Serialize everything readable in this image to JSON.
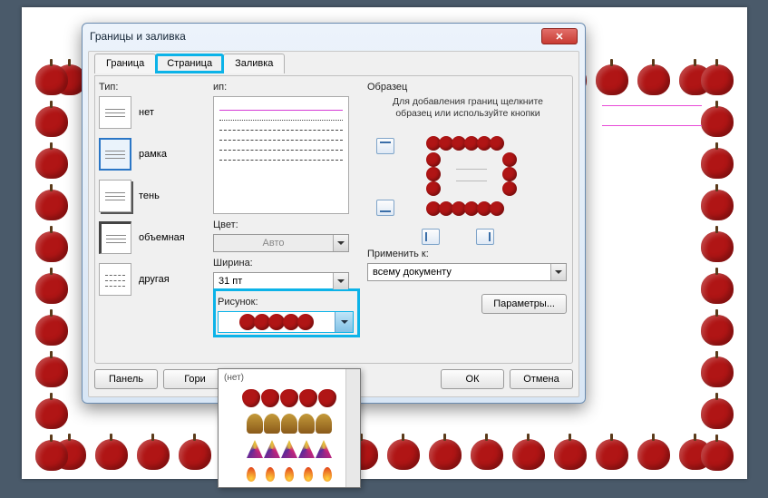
{
  "dialog": {
    "title": "Границы и заливка",
    "tabs": {
      "border": "Граница",
      "page": "Страница",
      "fill": "Заливка"
    },
    "type_label": "Тип:",
    "settings": {
      "none": "нет",
      "box": "рамка",
      "shadow": "тень",
      "threed": "объемная",
      "custom": "другая"
    },
    "style_label": "ип:",
    "color_label": "Цвет:",
    "color_value": "Авто",
    "width_label": "Ширина:",
    "width_value": "31 пт",
    "art_label": "Рисунок:",
    "preview_label": "Образец",
    "preview_help": "Для добавления границ щелкните образец или используйте кнопки",
    "apply_label": "Применить к:",
    "apply_value": "всему документу",
    "params_btn": "Параметры...",
    "bottom": {
      "panel": "Панель",
      "horiz": "Гори",
      "ok": "ОК",
      "cancel": "Отмена"
    },
    "dropdown_none": "(нет)"
  }
}
